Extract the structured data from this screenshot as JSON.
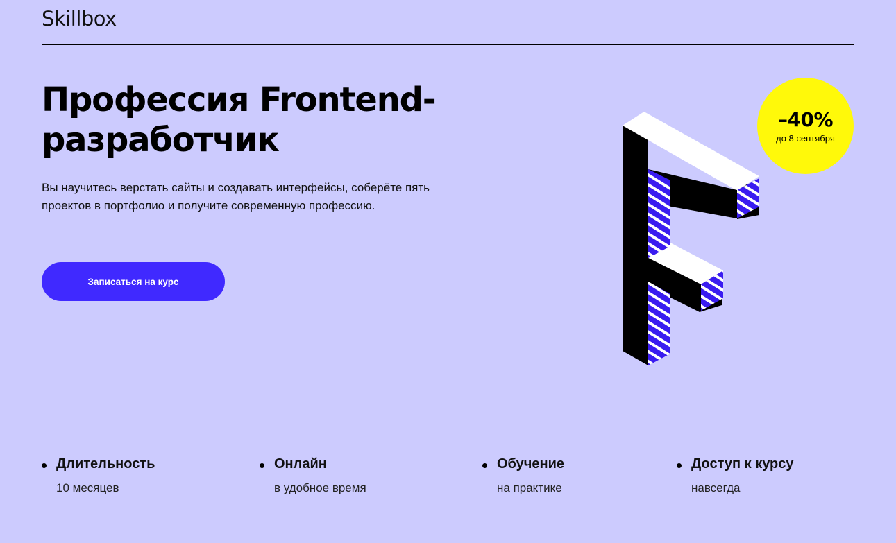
{
  "header": {
    "logo": "Skillbox"
  },
  "hero": {
    "title_line1": "Профессия Frontend-",
    "title_line2": "разработчик",
    "description": "Вы научитесь верстать сайты и создавать интерфейсы, соберёте пять проектов в портфолио и получите современную профессию.",
    "cta_label": "Записаться на курс"
  },
  "discount": {
    "value": "–40%",
    "until": "до 8 сентября"
  },
  "colors": {
    "background": "#cccbfe",
    "accent": "#4029ff",
    "badge": "#fff90a"
  },
  "features": [
    {
      "title": "Длительность",
      "value": "10 месяцев"
    },
    {
      "title": "Онлайн",
      "value": "в удобное время"
    },
    {
      "title": "Обучение",
      "value": "на практике"
    },
    {
      "title": "Доступ к курсу",
      "value": "навсегда"
    }
  ]
}
